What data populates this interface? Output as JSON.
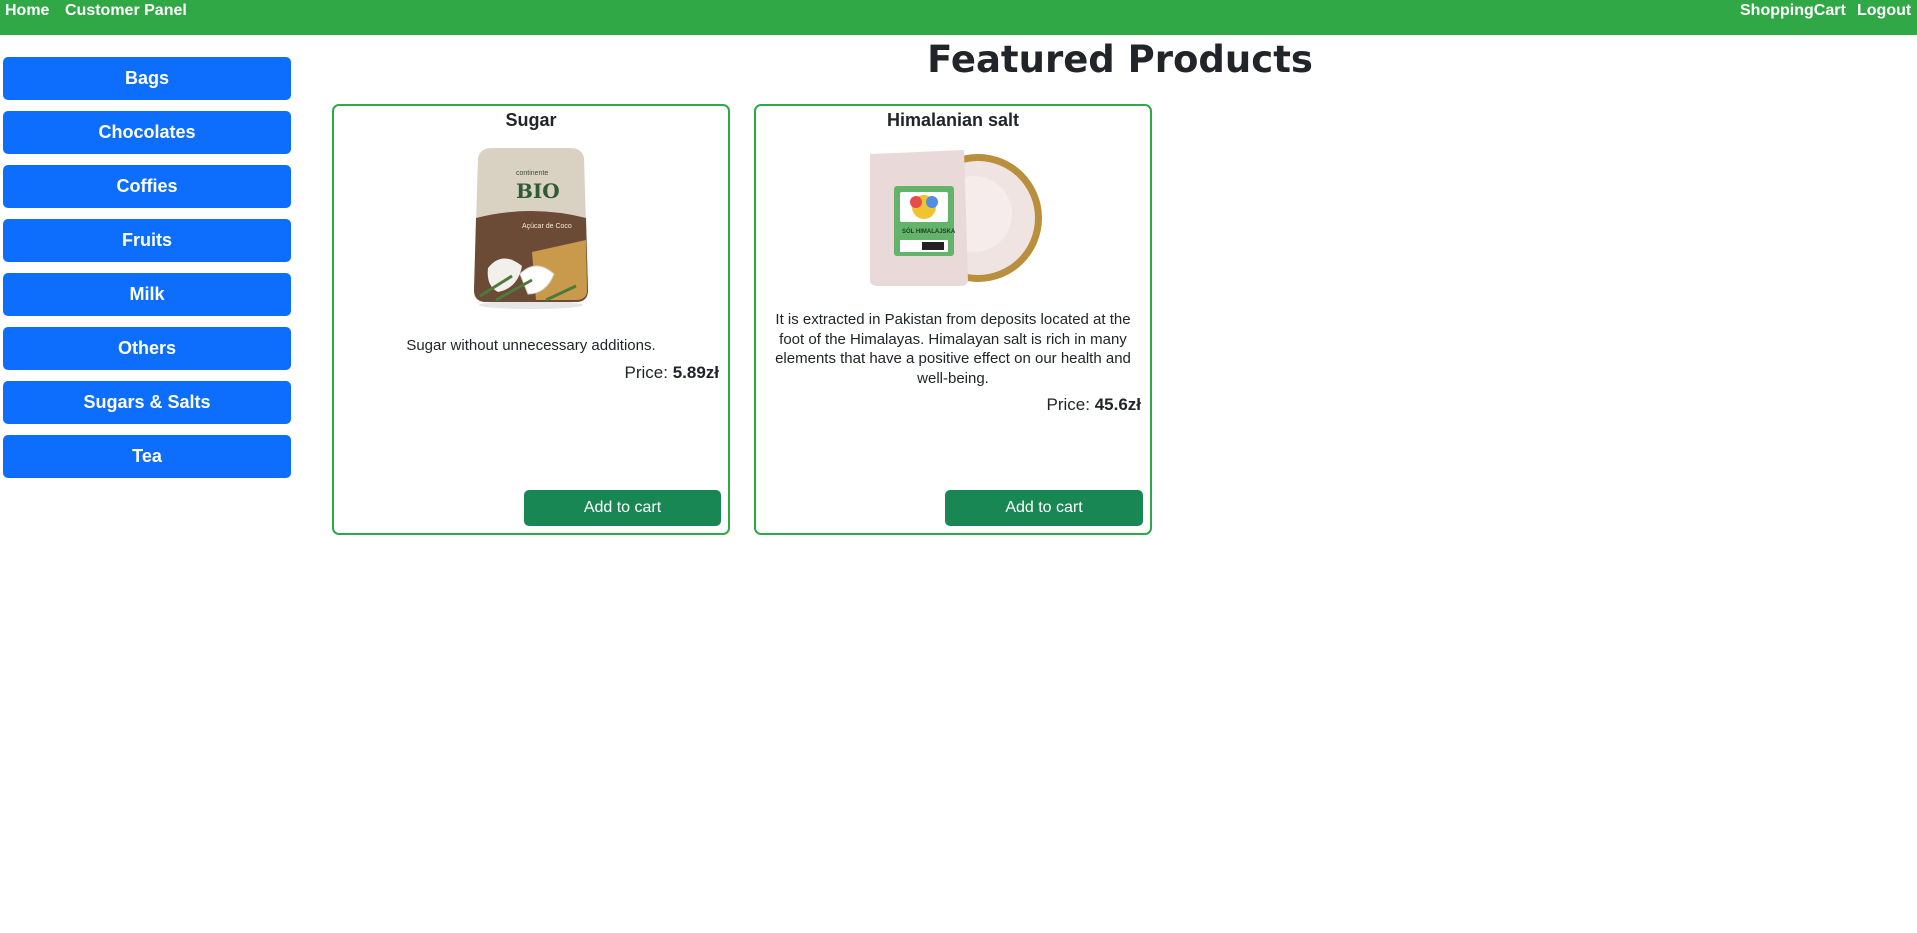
{
  "nav": {
    "home": "Home",
    "customer_panel": "Customer Panel",
    "cart": "ShoppingCart",
    "logout": "Logout"
  },
  "sidebar": {
    "categories": [
      "Bags",
      "Chocolates",
      "Coffies",
      "Fruits",
      "Milk",
      "Others",
      "Sugars & Salts",
      "Tea"
    ]
  },
  "main": {
    "title": "Featured Products",
    "products": [
      {
        "name": "Sugar",
        "image_text_brand": "BIO",
        "image_text_small": "continente",
        "image_text_label": "Açúcar de Coco",
        "description": "Sugar without unnecessary additions.",
        "price_label": "Price:",
        "price": "5.89zł",
        "button": "Add to cart"
      },
      {
        "name": "Himalanian salt",
        "image_text_label": "SÓL HIMALAJSKA",
        "description": "It is extracted in Pakistan from deposits located at the foot of the Himalayas. Himalayan salt is rich in many elements that have a positive effect on our health and well-being.",
        "price_label": "Price:",
        "price": "45.6zł",
        "button": "Add to cart"
      }
    ]
  },
  "colors": {
    "navbar": "#31a846",
    "category_button": "#0d6efd",
    "card_border": "#2fa84a",
    "add_button": "#198754"
  }
}
